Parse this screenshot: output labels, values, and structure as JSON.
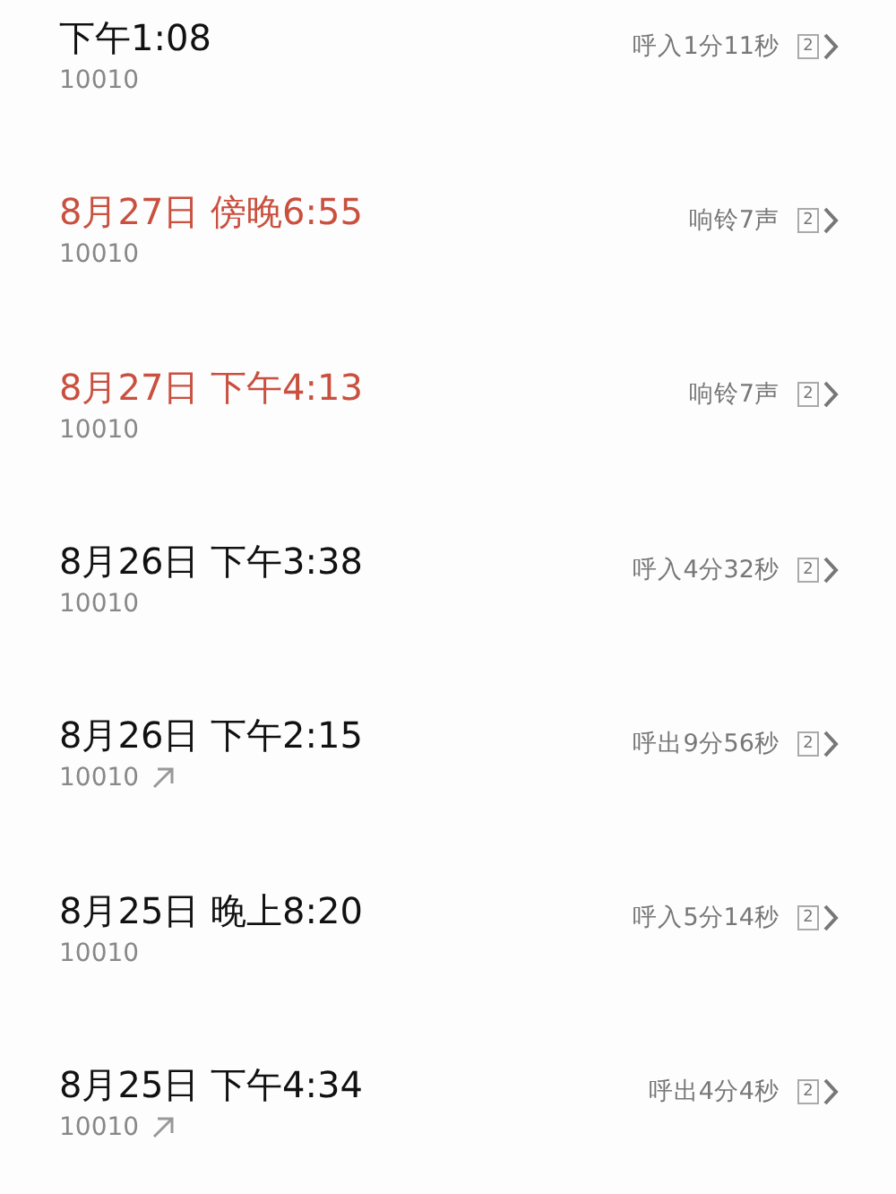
{
  "calls": [
    {
      "time": "下午1:08",
      "number": "10010",
      "missed": false,
      "outgoing": false,
      "detail": "呼入1分11秒",
      "sim": "2"
    },
    {
      "time": "8月27日 傍晚6:55",
      "number": "10010",
      "missed": true,
      "outgoing": false,
      "detail": "响铃7声",
      "sim": "2"
    },
    {
      "time": "8月27日 下午4:13",
      "number": "10010",
      "missed": true,
      "outgoing": false,
      "detail": "响铃7声",
      "sim": "2"
    },
    {
      "time": "8月26日 下午3:38",
      "number": "10010",
      "missed": false,
      "outgoing": false,
      "detail": "呼入4分32秒",
      "sim": "2"
    },
    {
      "time": "8月26日 下午2:15",
      "number": "10010",
      "missed": false,
      "outgoing": true,
      "detail": "呼出9分56秒",
      "sim": "2"
    },
    {
      "time": "8月25日 晚上8:20",
      "number": "10010",
      "missed": false,
      "outgoing": false,
      "detail": "呼入5分14秒",
      "sim": "2"
    },
    {
      "time": "8月25日 下午4:34",
      "number": "10010",
      "missed": false,
      "outgoing": true,
      "detail": "呼出4分4秒",
      "sim": "2"
    }
  ]
}
